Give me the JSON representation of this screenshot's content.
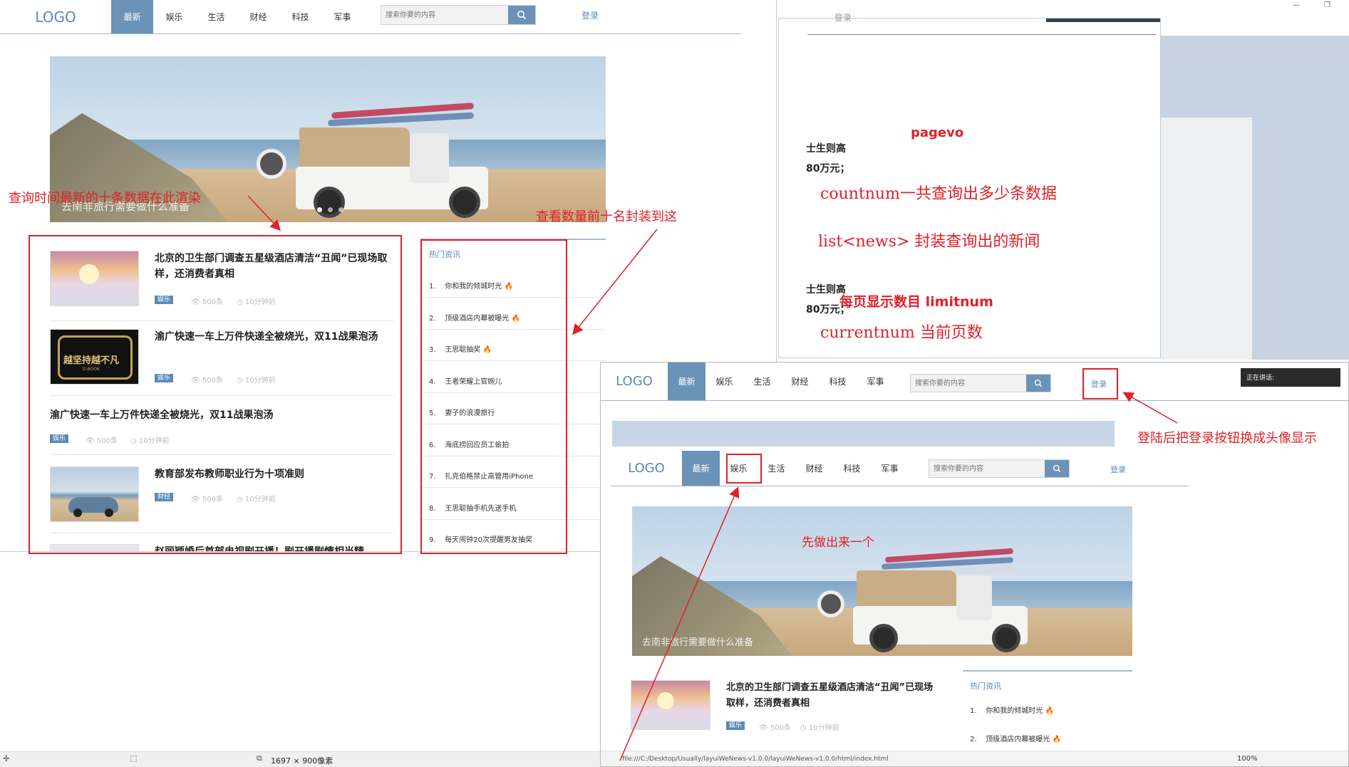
{
  "shot1": {
    "logo": "LOGO",
    "nav": [
      "最新",
      "娱乐",
      "生活",
      "财经",
      "科技",
      "军事"
    ],
    "search_placeholder": "搜索你要的内容",
    "login": "登录",
    "banner_caption": "去南非旅行需要做什么准备",
    "news": [
      {
        "title": "北京的卫生部门调查五星级酒店清洁“丑闻”已现场取样，还消费者真相",
        "tag": "娱乐",
        "views": "500条",
        "time": "10分钟前"
      },
      {
        "title": "渝广快速一车上万件快递全被烧光，双11战果泡汤",
        "tag": "娱乐",
        "views": "500条",
        "time": "10分钟前"
      },
      {
        "title": "渝广快速一车上万件快递全被烧光，双11战果泡汤",
        "tag": "娱乐",
        "views": "500条",
        "time": "10分钟前"
      },
      {
        "title": "教育部发布教师职业行为十项准则",
        "tag": "财经",
        "views": "500条",
        "time": "10分钟前"
      },
      {
        "title": "赵丽颖婚后首部电视剧开播！剧开播剧情相当精",
        "tag": "",
        "views": "",
        "time": ""
      }
    ],
    "thumb2_text": "越坚持越不凡",
    "thumb2_sub": "D-BOOK",
    "hot_title": "热门资讯",
    "hot": [
      "你和我的倾城时光",
      "顶级酒店内幕被曝光",
      "王思聪抽奖",
      "王者荣耀上官婉儿",
      "妻子的浪漫旅行",
      "海底捞回应员工偷拍",
      "扎克伯格禁止高管用iPhone",
      "王思聪抽手机先送手机",
      "每天闹钟20次提醒男友抽奖"
    ],
    "hot_fire": [
      true,
      true,
      true,
      false,
      false,
      false,
      false,
      false,
      false
    ]
  },
  "annotations": {
    "left": "查询时间最新的十条数据在此渲染",
    "right": "查看数量前十名封装到这",
    "login_change": "登陆后把登录按钮换成头像显示",
    "first_one": "先做出来一个"
  },
  "doc": {
    "top_text": "登录",
    "frag1": "士生则高",
    "frag2": "80万元；",
    "frag3": "士生则高",
    "frag4": "80万元；",
    "pagevo": "pagevo",
    "countnum": "countnum一共查询出多少条数据",
    "list": "list<news> 封装查询出的新闻",
    "limit": "每页显示数目  limitnum",
    "current": "currentnum 当前页数"
  },
  "win_controls": {
    "minimize": "—",
    "restore": "❐"
  },
  "shot2": {
    "logo": "LOGO",
    "nav": [
      "最新",
      "娱乐",
      "生活",
      "财经",
      "科技",
      "军事"
    ],
    "search_placeholder": "搜索你要的内容",
    "login": "登录",
    "popup": "正在讲话:"
  },
  "shot3": {
    "logo": "LOGO",
    "nav": [
      "最新",
      "娱乐",
      "生活",
      "财经",
      "科技",
      "军事"
    ],
    "search_placeholder": "搜索你要的内容",
    "login": "登录",
    "banner_caption": "去南非旅行需要做什么准备",
    "news_title": "北京的卫生部门调查五星级酒店清洁“丑闻”已现场取样，还消费者真相",
    "tag": "娱乐",
    "views": "500条",
    "time": "10分钟前",
    "hot_title": "热门资讯",
    "hot": [
      "你和我的倾城时光",
      "顶级酒店内幕被曝光"
    ],
    "path": "file:///C:/Desktop/Usually/layuiWeNews-v1.0.0/layuiWeNews-v1.0.0/html/index.html",
    "zoom": "100%"
  },
  "statusbar": {
    "dims": "1697 × 900像素"
  }
}
